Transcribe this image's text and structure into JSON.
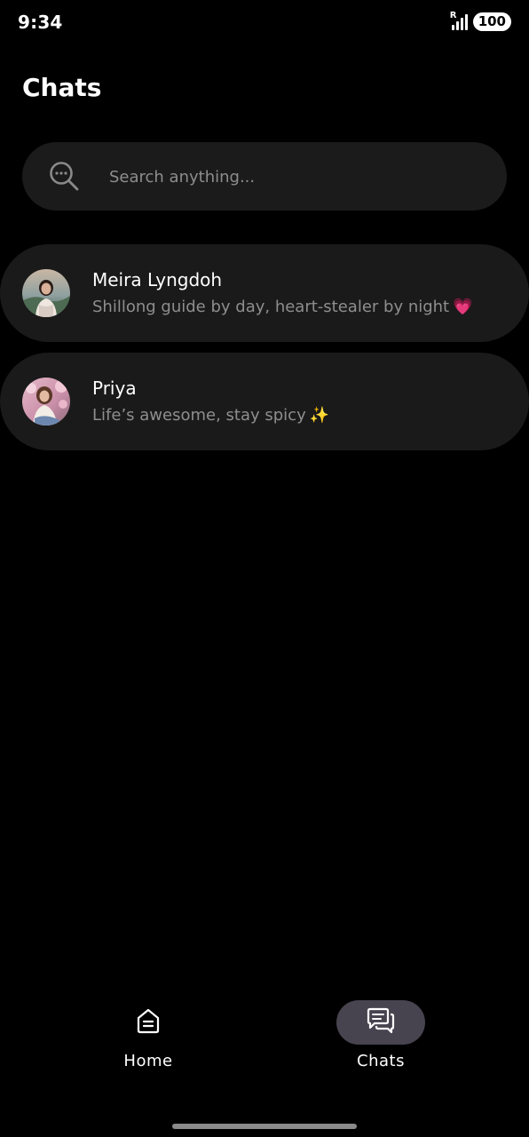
{
  "status_bar": {
    "time": "9:34",
    "network_indicator": "R",
    "battery": "100"
  },
  "header": {
    "title": "Chats"
  },
  "search": {
    "placeholder": "Search anything...",
    "value": "",
    "icon": "search-chat-icon"
  },
  "chats": [
    {
      "name": "Meira Lyngdoh",
      "preview": "Shillong guide by day, heart-stealer by night",
      "emoji": "💗",
      "avatar": "avatar-photo"
    },
    {
      "name": "Priya",
      "preview": "Life’s awesome, stay spicy",
      "emoji": "✨",
      "avatar": "avatar-photo"
    }
  ],
  "bottom_nav": {
    "items": [
      {
        "label": "Home",
        "icon": "home-icon",
        "active": false
      },
      {
        "label": "Chats",
        "icon": "chats-icon",
        "active": true
      }
    ]
  },
  "colors": {
    "background": "#000000",
    "surface": "#1a1a1a",
    "secondary_text": "#8e8e8e",
    "active_pill": "#47434f"
  }
}
